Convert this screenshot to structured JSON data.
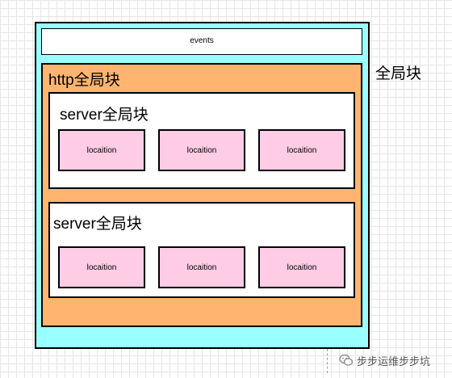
{
  "diagram": {
    "global_label": "全局块",
    "events_label": "events",
    "http_label": "http全局块",
    "servers": [
      {
        "label": "server全局块",
        "locations": [
          "locaition",
          "locaition",
          "locaition"
        ]
      },
      {
        "label": "server全局块",
        "locations": [
          "locaition",
          "locaition",
          "locaition"
        ]
      }
    ]
  },
  "colors": {
    "global_block": "#99ffff",
    "http_block": "#ffb570",
    "server_block": "#ffffff",
    "location_block": "#ffcce6"
  },
  "watermark": {
    "text": "步步运维步步坑",
    "icon": "wechat-logo-icon"
  }
}
